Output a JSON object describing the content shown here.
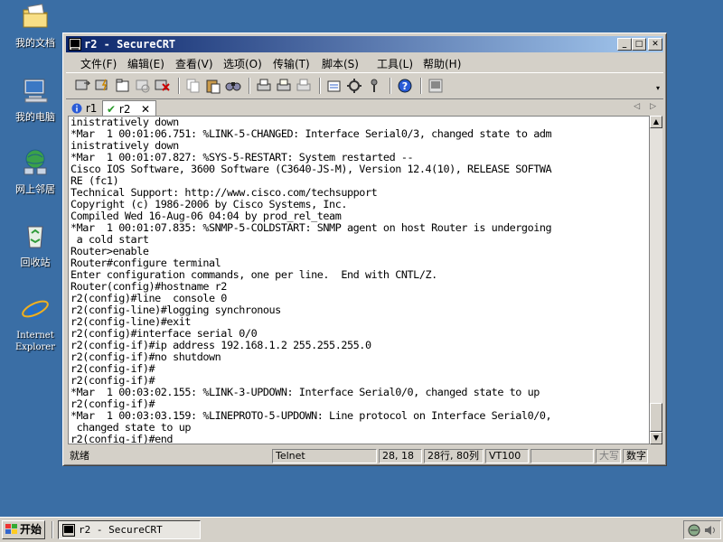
{
  "desktop": {
    "icons": [
      {
        "label": "我的文档",
        "icon": "folder-documents-icon"
      },
      {
        "label": "我的电脑",
        "icon": "computer-icon"
      },
      {
        "label": "网上邻居",
        "icon": "network-places-icon"
      },
      {
        "label": "回收站",
        "icon": "recycle-bin-icon"
      },
      {
        "label": "Internet Explorer",
        "icon": "internet-explorer-icon"
      }
    ]
  },
  "window": {
    "title": "r2 - SecureCRT",
    "controls": {
      "minimize": "_",
      "maximize": "□",
      "close": "✕"
    }
  },
  "menu": [
    "文件(F)",
    "编辑(E)",
    "查看(V)",
    "选项(O)",
    "传输(T)",
    "脚本(S)",
    "工具(L)",
    "帮助(H)"
  ],
  "tabs": [
    {
      "label": "r1",
      "status": "info",
      "active": false
    },
    {
      "label": "r2",
      "status": "connected",
      "active": true
    }
  ],
  "terminal": {
    "lines": [
      "inistratively down",
      "*Mar  1 00:01:06.751: %LINK-5-CHANGED: Interface Serial0/3, changed state to adm",
      "inistratively down",
      "*Mar  1 00:01:07.827: %SYS-5-RESTART: System restarted --",
      "Cisco IOS Software, 3600 Software (C3640-JS-M), Version 12.4(10), RELEASE SOFTWA",
      "RE (fc1)",
      "Technical Support: http://www.cisco.com/techsupport",
      "Copyright (c) 1986-2006 by Cisco Systems, Inc.",
      "Compiled Wed 16-Aug-06 04:04 by prod_rel_team",
      "*Mar  1 00:01:07.835: %SNMP-5-COLDSTART: SNMP agent on host Router is undergoing",
      " a cold start",
      "Router>enable",
      "Router#configure terminal",
      "Enter configuration commands, one per line.  End with CNTL/Z.",
      "Router(config)#hostname r2",
      "r2(config)#line  console 0",
      "r2(config-line)#logging synchronous",
      "r2(config-line)#exit",
      "r2(config)#interface serial 0/0",
      "r2(config-if)#ip address 192.168.1.2 255.255.255.0",
      "r2(config-if)#no shutdown",
      "r2(config-if)#",
      "r2(config-if)#",
      "*Mar  1 00:03:02.155: %LINK-3-UPDOWN: Interface Serial0/0, changed state to up",
      "r2(config-if)#",
      "*Mar  1 00:03:03.159: %LINEPROTO-5-UPDOWN: Line protocol on Interface Serial0/0,",
      " changed state to up",
      "r2(config-if)#end"
    ]
  },
  "status": {
    "ready": "就绪",
    "protocol": "Telnet",
    "cursor": "28, 18",
    "rows_cols": "28行, 80列",
    "emulation": "VT100",
    "caps": "大写",
    "num": "数字"
  },
  "taskbar": {
    "start_label": "开始",
    "task_label": "r2 - SecureCRT"
  }
}
